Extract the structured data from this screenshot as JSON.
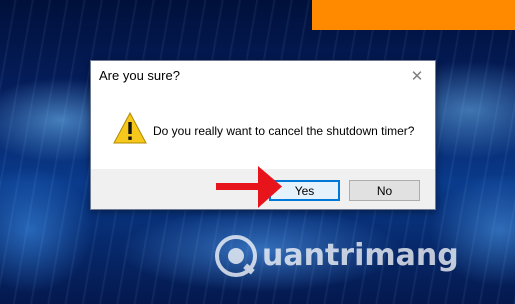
{
  "dialog": {
    "title": "Are you sure?",
    "close_icon": "close-icon",
    "icon": "warning-icon",
    "message": "Do you really want to cancel the shutdown timer?",
    "buttons": {
      "yes": "Yes",
      "no": "No"
    }
  },
  "overlay": {
    "arrow_icon": "red-arrow-icon",
    "arrow_color": "#e8141b",
    "watermark": "uantrimang"
  },
  "colors": {
    "accent": "#0078d7",
    "orange_bar": "#ff8a00",
    "warning": "#f7c81c"
  }
}
